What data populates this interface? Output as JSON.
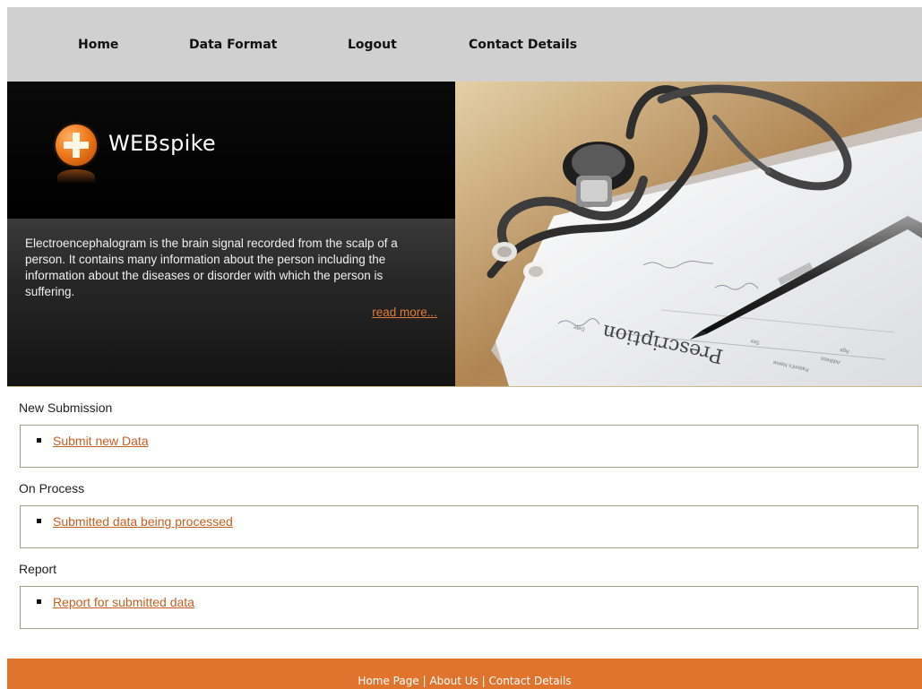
{
  "nav": {
    "items": [
      {
        "label": "Home"
      },
      {
        "label": "Data Format"
      },
      {
        "label": "Logout"
      },
      {
        "label": "Contact Details"
      }
    ]
  },
  "hero": {
    "logo_text": "WEBspike",
    "description": "Electroencephalogram is the brain signal recorded from the scalp of a person. It contains many information about the person including the information about the diseases or disorder with which the person is suffering.",
    "read_more": "read more...",
    "image": {
      "icon": "stethoscope-prescription-photo",
      "prescription_text": "Prescription",
      "form_labels": [
        "Patient's Name",
        "Address",
        "Age",
        "Sex",
        "Date"
      ]
    }
  },
  "sections": [
    {
      "title": "New Submission",
      "link": "Submit new Data"
    },
    {
      "title": "On Process",
      "link": "Submitted data being processed"
    },
    {
      "title": "Report",
      "link": "Report for submitted data"
    }
  ],
  "footer": {
    "links": [
      "Home Page",
      "About Us",
      "Contact Details"
    ],
    "separator": "|"
  },
  "colors": {
    "accent": "#e0732d",
    "link": "#c65f22",
    "nav_bg": "#d0d0d0",
    "box_border": "#9aa386"
  }
}
